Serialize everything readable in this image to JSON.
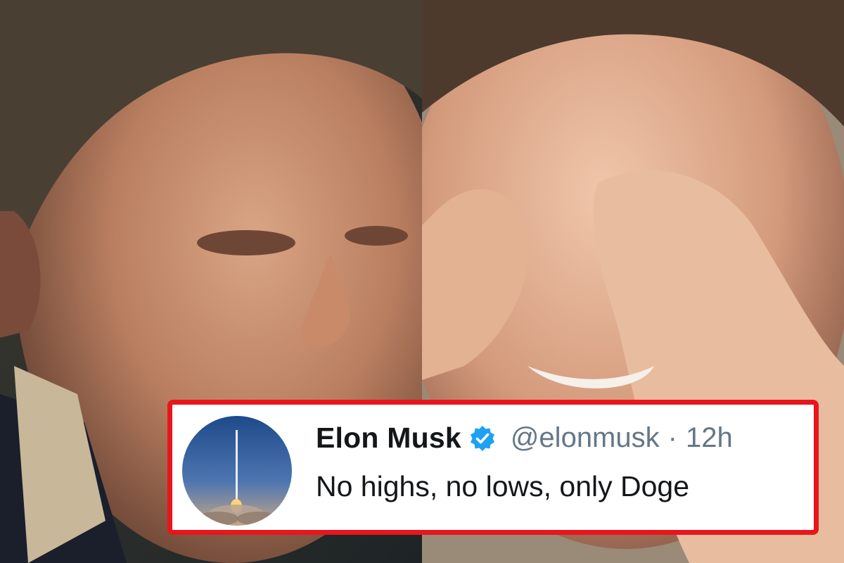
{
  "tweet": {
    "display_name": "Elon Musk",
    "handle": "@elonmusk",
    "separator": "·",
    "time": "12h",
    "text": "No highs, no lows, only Doge",
    "verified": true
  },
  "colors": {
    "card_border": "#e8161c",
    "verified_blue": "#1da1f2",
    "name_text": "#14171a",
    "secondary_text": "#657786"
  },
  "icons": {
    "verified": "verified-badge-icon",
    "avatar": "rocket-launch-avatar"
  }
}
